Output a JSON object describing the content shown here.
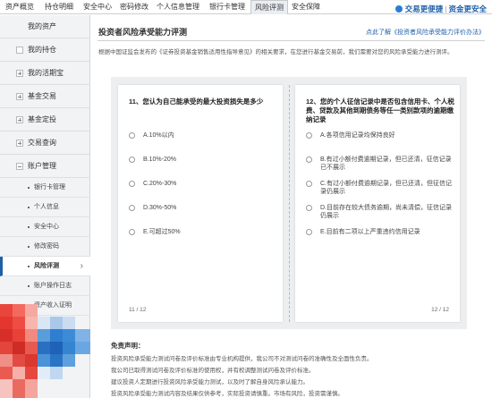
{
  "topnav": {
    "tabs": [
      "资产概览",
      "持仓明细",
      "安全中心",
      "密码修改",
      "个人信息管理",
      "银行卡管理",
      "风险评测",
      "安全保障"
    ],
    "active_index": 6,
    "right_primary": "交易更便捷",
    "right_secondary": "资金更安全"
  },
  "sidebar": {
    "items": [
      "我的资产",
      "我的持仓",
      "我的活期宝",
      "基金交易",
      "基金定投",
      "交易查询",
      "账户管理"
    ],
    "subitems": [
      "银行卡管理",
      "个人信息",
      "安全中心",
      "修改密码",
      "风险评测",
      "账户操作日志",
      "资产收入证明"
    ],
    "active_sub_index": 4
  },
  "main": {
    "title": "投资者风险承受能力评测",
    "help_link": "点此了解《投资者风险承受能力评价办法》",
    "intro": "根据中国证监会发布的《证券投资基金销售适用性指导意见》的相关要求，在您进行基金交易前，我们需要对您的风险承受能力进行测评。",
    "questions": [
      {
        "title": "11、您认为自己能承受的最大投资损失是多少",
        "options": [
          "A.10%以内",
          "B.10%-20%",
          "C.20%-30%",
          "D.30%-50%",
          "E.可超过50%"
        ],
        "pager": "11 / 12"
      },
      {
        "title": "12、您的个人征信记录中是否包含信用卡、个人税费、贷款及其他到期债务等任一类别款项的逾期缴纳记录",
        "options": [
          "A.各项信用记录均保持良好",
          "B.有过小额付费逾期记录，但已还清，征信记录已不展示",
          "C.有过小额付费逾期记录，但已还清，但征信记录仍展示",
          "D.目前存在较大债务逾期，尚未清偿，征信记录仍展示",
          "E.目前有二项以上严重违约信用记录"
        ],
        "pager": "12 / 12"
      }
    ],
    "disclaimer": {
      "title": "免责声明：",
      "lines": [
        "投资风险承受能力测试问卷及评价标准由专业机构提供，我公司不对测试问卷的准确性及全面性负责。",
        "我公司已取得测试问卷及评价标准的使用权，并有权调整测试问卷及评价标准。",
        "建议投资人定期进行投资风险承受能力测试，以及时了解自身风险承认能力。",
        "投资风险承受能力测试内容及结果仅供参考，实际投资请慎重。市场有风险，投资需谨慎。"
      ]
    }
  },
  "colors": {
    "accent": "#1f5fa8",
    "sidebar_bg": "#f1f3f5",
    "panel_bg": "#eceef0"
  }
}
